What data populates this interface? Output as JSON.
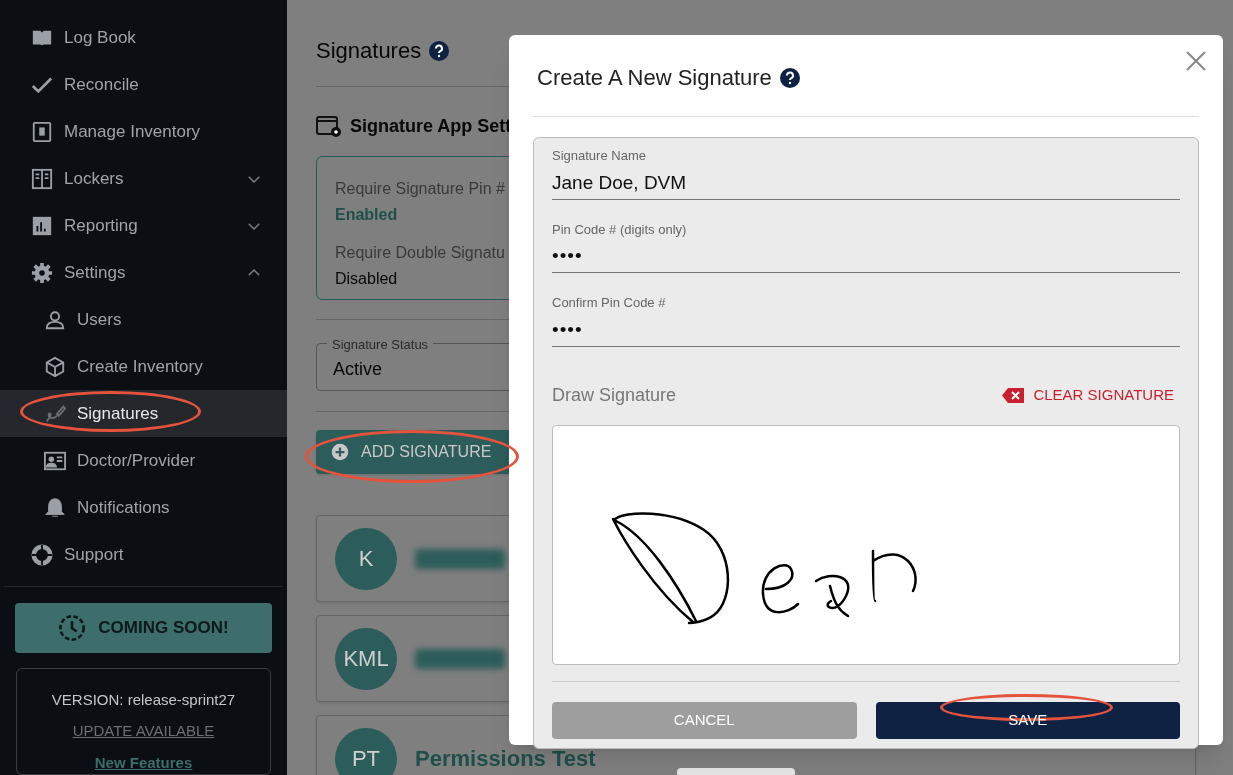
{
  "sidebar": {
    "items": [
      {
        "label": "Log Book",
        "sub": false,
        "selected": false
      },
      {
        "label": "Reconcile",
        "sub": false,
        "selected": false
      },
      {
        "label": "Manage Inventory",
        "sub": false,
        "selected": false
      },
      {
        "label": "Lockers",
        "sub": false,
        "selected": false,
        "expanded": false
      },
      {
        "label": "Reporting",
        "sub": false,
        "selected": false,
        "expanded": false
      },
      {
        "label": "Settings",
        "sub": false,
        "selected": false,
        "expanded": true
      },
      {
        "label": "Users",
        "sub": true,
        "selected": false
      },
      {
        "label": "Create Inventory",
        "sub": true,
        "selected": false
      },
      {
        "label": "Signatures",
        "sub": true,
        "selected": true
      },
      {
        "label": "Doctor/Provider",
        "sub": true,
        "selected": false
      },
      {
        "label": "Notifications",
        "sub": true,
        "selected": false
      },
      {
        "label": "Support",
        "sub": false,
        "selected": false
      }
    ],
    "coming_soon": "COMING SOON!",
    "version": "VERSION: release-sprint27",
    "update": "UPDATE AVAILABLE",
    "new_features": "New Features"
  },
  "page": {
    "title": "Signatures",
    "settings_title": "Signature App Sett",
    "settings": [
      {
        "label": "Require Signature Pin #",
        "value": "Enabled",
        "on": true
      },
      {
        "label": "Require Double Signatu",
        "value": "Disabled",
        "on": false
      }
    ],
    "status_filter": {
      "label": "Signature Status",
      "value": "Active"
    },
    "add_button": "ADD SIGNATURE",
    "signatures": [
      {
        "initials": "K"
      },
      {
        "initials": "KML"
      },
      {
        "initials": "PT",
        "name": "Permissions Test"
      }
    ]
  },
  "dialog": {
    "title": "Create A New Signature",
    "fields": [
      {
        "label": "Signature Name",
        "value": "Jane Doe, DVM"
      },
      {
        "label": "Pin Code # (digits only)",
        "value": "••••"
      },
      {
        "label": "Confirm Pin Code #",
        "value": "••••"
      }
    ],
    "draw_label": "Draw Signature",
    "clear": "CLEAR SIGNATURE",
    "cancel": "CANCEL",
    "save": "SAVE"
  },
  "annotations": [
    {
      "kind": "ellipse"
    },
    {
      "kind": "ellipse"
    },
    {
      "kind": "ellipse"
    }
  ]
}
